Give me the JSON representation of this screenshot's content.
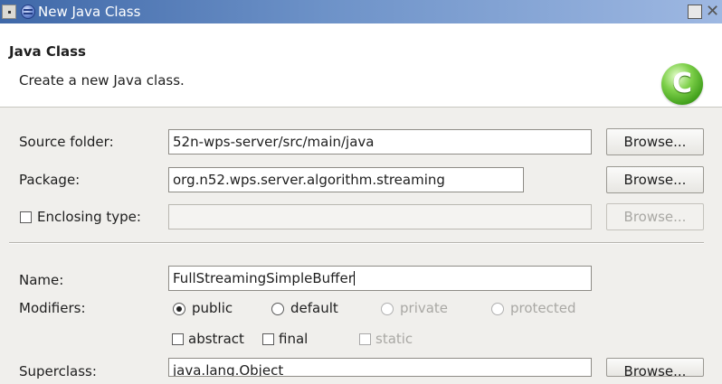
{
  "window": {
    "title": "New Java Class"
  },
  "header": {
    "title": "Java Class",
    "description": "Create a new Java class."
  },
  "form": {
    "source_folder": {
      "label": "Source folder:",
      "value": "52n-wps-server/src/main/java",
      "button": "Browse..."
    },
    "package": {
      "label": "Package:",
      "value": "org.n52.wps.server.algorithm.streaming",
      "button": "Browse..."
    },
    "enclosing_type": {
      "label": "Enclosing type:",
      "value": "",
      "button": "Browse...",
      "checked": false
    },
    "name": {
      "label": "Name:",
      "value": "FullStreamingSimpleBuffer"
    },
    "modifiers": {
      "label": "Modifiers:",
      "options": [
        "public",
        "default",
        "private",
        "protected"
      ],
      "selected": "public",
      "abstract": "abstract",
      "final": "final",
      "static": "static"
    },
    "superclass": {
      "label": "Superclass:",
      "value": "java.lang.Object",
      "button": "Browse..."
    }
  }
}
